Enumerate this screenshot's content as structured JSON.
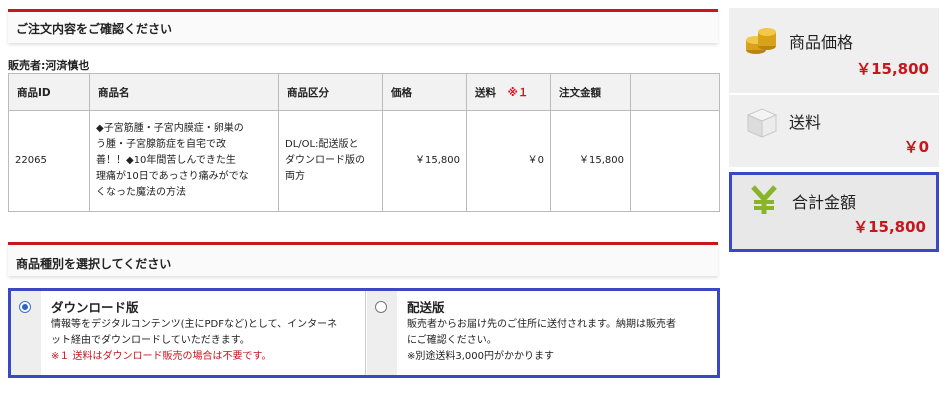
{
  "confirm_header": "ご注文内容をご確認ください",
  "seller": "販売者:河済慎也",
  "table": {
    "headers": [
      "商品ID",
      "商品名",
      "商品区分",
      "価格",
      "送料",
      "※１",
      "注文金額"
    ],
    "row": {
      "id": "22065",
      "name_lines": [
        "◆子宮筋腫・子宮内膜症・卵巣の",
        "う腫・子宮腺筋症を自宅で改",
        "善！！◆10年間苦しんできた生",
        "理痛が10日であっさり痛みがでな",
        "くなった魔法の方法"
      ],
      "category_lines": [
        "DL/OL:配送版と",
        "ダウンロード版の",
        "両方"
      ],
      "price": "￥15,800",
      "shipping": "￥0",
      "total": "￥15,800"
    }
  },
  "type_header": "商品種別を選択してください",
  "options": [
    {
      "title": "ダウンロード版",
      "desc_lines": [
        "情報等をデジタルコンテンツ(主にPDFなど)として、インターネ",
        "ット経由でダウンロードしていただきます。"
      ],
      "note": "※１ 送料はダウンロード販売の場合は不要です。",
      "selected": true
    },
    {
      "title": "配送版",
      "desc_lines": [
        "販売者からお届け先のご住所に送付されます。納期は販売者",
        "にご確認ください。",
        "※別途送料3,000円がかかります"
      ],
      "selected": false
    }
  ],
  "summary": {
    "price_label": "商品価格",
    "price_value": "￥15,800",
    "shipping_label": "送料",
    "shipping_value": "￥0",
    "total_label": "合計金額",
    "total_value": "￥15,800"
  },
  "colors": {
    "accent_red": "#c8161d",
    "highlight_blue": "#3a48c5",
    "yen_green": "#8ab52a",
    "coin_gold": "#d9a21b"
  },
  "icons": {
    "price": "coins-icon",
    "shipping": "box-icon",
    "total": "yen-icon"
  }
}
